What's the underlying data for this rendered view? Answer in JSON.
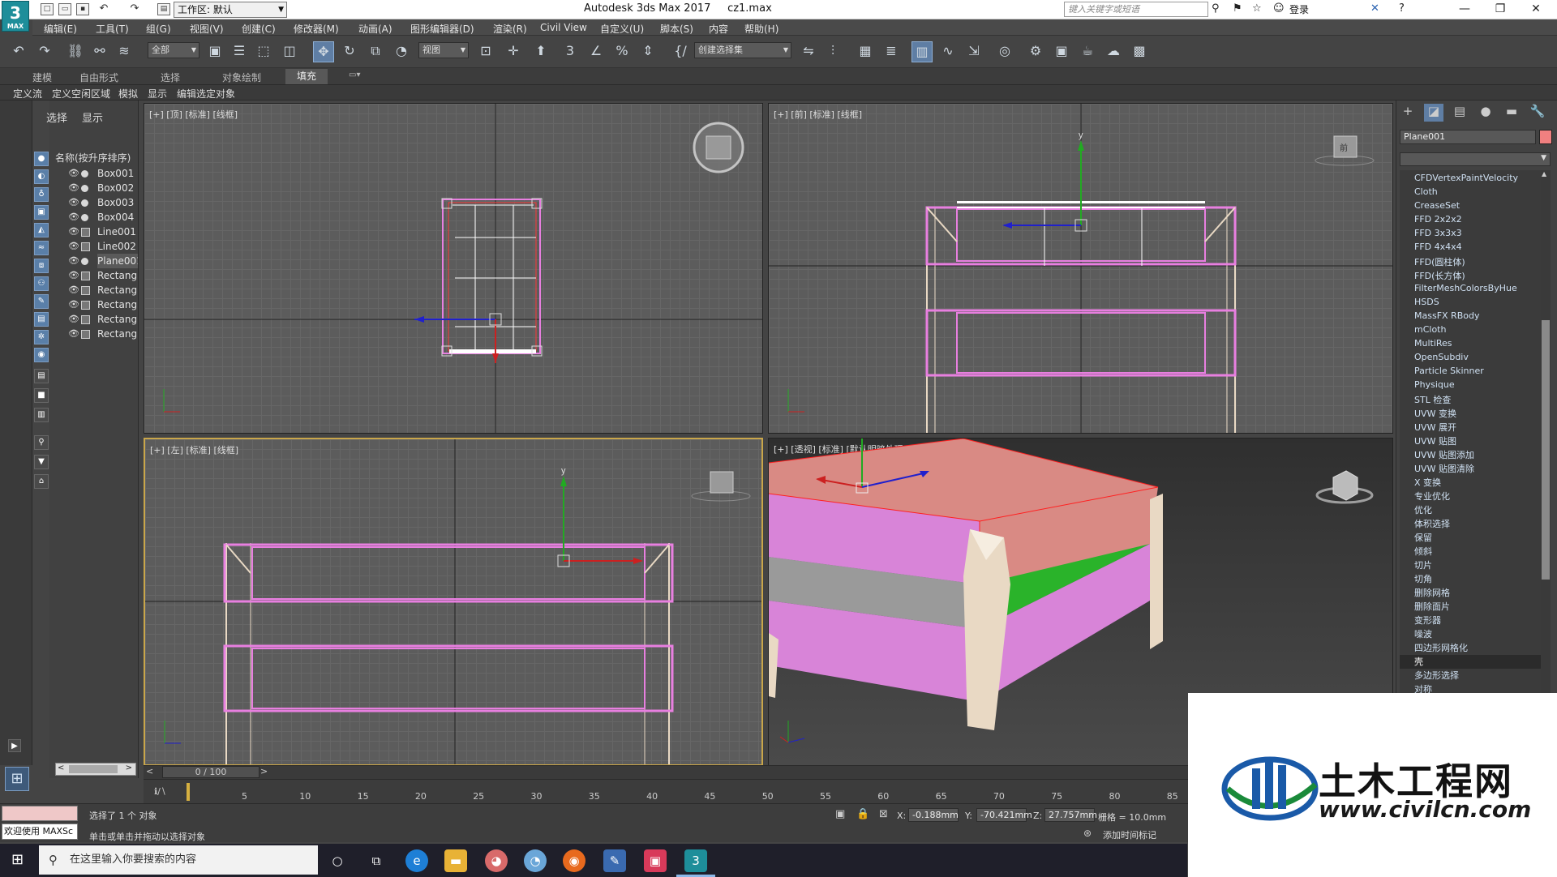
{
  "titlebar": {
    "workspace": "工作区: 默认",
    "title": "Autodesk 3ds Max 2017",
    "filename": "cz1.max",
    "search_placeholder": "键入关键字或短语",
    "login": "登录",
    "app_logo": "3",
    "app_logo_sub": "MAX"
  },
  "menu": [
    "编辑(E)",
    "工具(T)",
    "组(G)",
    "视图(V)",
    "创建(C)",
    "修改器(M)",
    "动画(A)",
    "图形编辑器(D)",
    "渲染(R)",
    "Civil View",
    "自定义(U)",
    "脚本(S)",
    "内容",
    "帮助(H)"
  ],
  "toolbar": {
    "filter": "全部",
    "refcoord": "视图",
    "selection_set": "创建选择集"
  },
  "ribbon": {
    "tabs": [
      "建模",
      "自由形式",
      "选择",
      "对象绘制",
      "填充"
    ],
    "active": "填充",
    "subtabs": [
      "定义流",
      "定义空闲区域",
      "模拟",
      "显示",
      "编辑选定对象"
    ]
  },
  "explorer": {
    "tabs": [
      "选择",
      "显示"
    ],
    "header": "名称(按升序排序)",
    "items": [
      {
        "name": "Box001",
        "kind": "obj"
      },
      {
        "name": "Box002",
        "kind": "obj"
      },
      {
        "name": "Box003",
        "kind": "obj"
      },
      {
        "name": "Box004",
        "kind": "obj"
      },
      {
        "name": "Line001",
        "kind": "shape"
      },
      {
        "name": "Line002",
        "kind": "shape"
      },
      {
        "name": "Plane001",
        "kind": "obj"
      },
      {
        "name": "Rectangl",
        "kind": "shape"
      },
      {
        "name": "Rectangl",
        "kind": "shape"
      },
      {
        "name": "Rectangl",
        "kind": "shape"
      },
      {
        "name": "Rectangl",
        "kind": "shape"
      },
      {
        "name": "Rectangl",
        "kind": "shape"
      }
    ],
    "selected_index": 6
  },
  "viewports": {
    "top": "[+] [顶] [标准] [线框]",
    "front": "[+] [前] [标准] [线框]",
    "left": "[+] [左] [标准] [线框]",
    "persp": "[+] [透视] [标准] [默认明暗处理]",
    "axis_y": "y",
    "viewcube_label": "前"
  },
  "command_panel": {
    "object_name": "Plane001",
    "object_color": "#f08080",
    "modifiers": [
      "CFDVertexPaintVelocity",
      "Cloth",
      "CreaseSet",
      "FFD 2x2x2",
      "FFD 3x3x3",
      "FFD 4x4x4",
      "FFD(圆柱体)",
      "FFD(长方体)",
      "FilterMeshColorsByHue",
      "HSDS",
      "MassFX RBody",
      "mCloth",
      "MultiRes",
      "OpenSubdiv",
      "Particle Skinner",
      "Physique",
      "STL 检查",
      "UVW 变换",
      "UVW 展开",
      "UVW 贴图",
      "UVW 贴图添加",
      "UVW 贴图清除",
      "X 变换",
      "专业优化",
      "优化",
      "体积选择",
      "保留",
      "倾斜",
      "切片",
      "切角",
      "删除网格",
      "删除面片",
      "变形器",
      "噪波",
      "四边形网格化",
      "壳",
      "多边形选择",
      "对称"
    ],
    "highlighted": "壳"
  },
  "timeline": {
    "frame": "0 / 100",
    "ticks": [
      "5",
      "10",
      "15",
      "20",
      "25",
      "30",
      "35",
      "40",
      "45",
      "50",
      "55",
      "60",
      "65",
      "70",
      "75",
      "80",
      "85"
    ]
  },
  "status": {
    "maxscript": "欢迎使用 MAXSc",
    "line1": "选择了 1 个 对象",
    "line2": "单击或单击并拖动以选择对象",
    "x_label": "X:",
    "x": "-0.188mm",
    "y_label": "Y:",
    "y": "-70.421mm",
    "z_label": "Z:",
    "z": "27.757mm",
    "grid": "栅格 = 10.0mm",
    "add_time_tag": "添加时间标记"
  },
  "taskbar": {
    "search": "在这里输入你要搜索的内容"
  },
  "watermark": {
    "title": "土木工程网",
    "url": "www.civilcn.com"
  },
  "colors": {
    "pink": "#e87fe0",
    "salmon": "#d98a84",
    "green": "#2ab32a",
    "leg": "#e9d9c4",
    "accent": "#5f7ea4"
  }
}
